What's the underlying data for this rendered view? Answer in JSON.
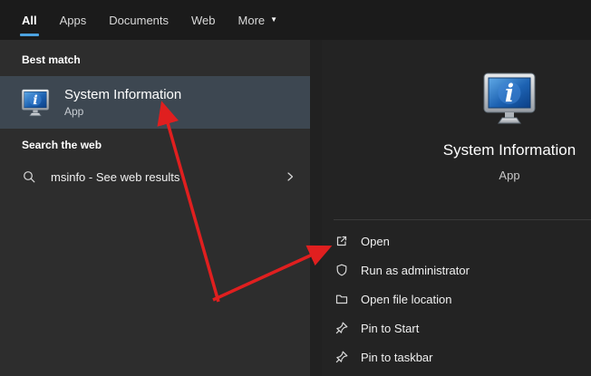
{
  "header": {
    "tabs": [
      {
        "label": "All",
        "active": true
      },
      {
        "label": "Apps",
        "active": false
      },
      {
        "label": "Documents",
        "active": false
      },
      {
        "label": "Web",
        "active": false
      },
      {
        "label": "More",
        "active": false,
        "has_dropdown": true
      }
    ]
  },
  "left_panel": {
    "section_best_match": "Best match",
    "best_match_item": {
      "title": "System Information",
      "type": "App",
      "icon": "system-information-monitor-icon"
    },
    "section_search_web": "Search the web",
    "web_result": {
      "icon": "search-icon",
      "text": "msinfo - See web results",
      "chevron": "chevron-right-icon"
    }
  },
  "preview_panel": {
    "icon": "system-information-monitor-icon",
    "app_title": "System Information",
    "app_type": "App",
    "actions": [
      {
        "label": "Open",
        "icon": "open-icon"
      },
      {
        "label": "Run as administrator",
        "icon": "admin-shield-icon"
      },
      {
        "label": "Open file location",
        "icon": "folder-icon"
      },
      {
        "label": "Pin to Start",
        "icon": "pin-icon"
      },
      {
        "label": "Pin to taskbar",
        "icon": "pin-icon"
      }
    ]
  },
  "annotations": {
    "arrows": [
      {
        "target": "best-match-item"
      },
      {
        "target": "open-action"
      }
    ]
  },
  "colors": {
    "accent": "#4ca2e0",
    "arrow": "#e01f1f",
    "best_match_highlight": "#3d4751"
  }
}
